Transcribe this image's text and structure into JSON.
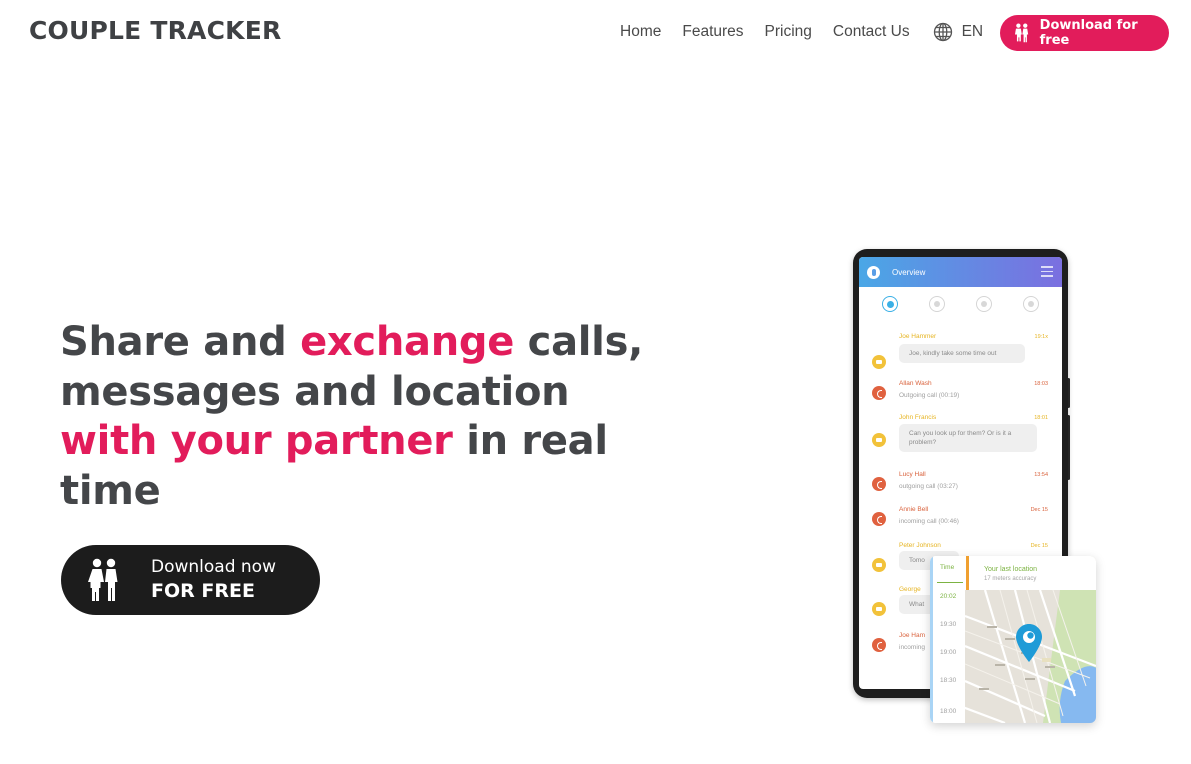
{
  "header": {
    "logo": "COUPLE TRACKER",
    "nav": [
      "Home",
      "Features",
      "Pricing",
      "Contact Us"
    ],
    "language": "EN",
    "language_icon": "globe-icon",
    "download_button": "Download for free",
    "download_icon": "couple-icon",
    "accent_color": "#e21c5b"
  },
  "hero": {
    "title_parts": [
      {
        "text": "Share and ",
        "highlight": false
      },
      {
        "text": "exchange",
        "highlight": true
      },
      {
        "text": " calls, messages and location ",
        "highlight": false
      },
      {
        "text": "with your partner",
        "highlight": true
      },
      {
        "text": " in real time",
        "highlight": false
      }
    ],
    "cta_line1": "Download now",
    "cta_line2": "FOR FREE"
  },
  "phone": {
    "app_title": "Overview",
    "tabs": [
      "overview-icon",
      "phone-icon",
      "message-icon",
      "location-icon"
    ],
    "feed": [
      {
        "type": "message",
        "name": "Joe Hammer",
        "time": "19:1x",
        "text": "Joe, kindly take some time out"
      },
      {
        "type": "call",
        "name": "Allan Wash",
        "time": "18:03",
        "text": "Outgoing call (00:19)"
      },
      {
        "type": "message",
        "name": "John Francis",
        "time": "18:01",
        "text": "Can you look up for them? Or is it a problem?"
      },
      {
        "type": "call",
        "name": "Lucy Hall",
        "time": "13:54",
        "text": "outgoing call (03:27)"
      },
      {
        "type": "call",
        "name": "Annie Bell",
        "time": "Dec 15",
        "text": "incoming call (00:46)"
      },
      {
        "type": "message",
        "name": "Peter Johnson",
        "time": "Dec 15",
        "text": "Tomo"
      },
      {
        "type": "message",
        "name": "George",
        "time": "",
        "text": "What"
      },
      {
        "type": "call",
        "name": "Joe Ham",
        "time": "",
        "text": "incoming"
      }
    ]
  },
  "location_card": {
    "time_label": "Time",
    "times": [
      "20:02",
      "19:30",
      "19:00",
      "18:30",
      "18:00"
    ],
    "title": "Your last location",
    "subtitle": "17 meters accuracy"
  }
}
